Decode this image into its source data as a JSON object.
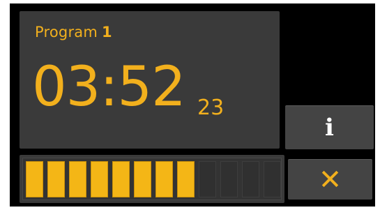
{
  "program": {
    "label": "Program",
    "number": "1"
  },
  "timer": {
    "main": "03:52",
    "seconds": "23"
  },
  "buttons": {
    "info_icon": "info-icon",
    "info_glyph": "i",
    "close_icon": "close-icon",
    "close_glyph": "✕"
  },
  "progress": {
    "filled_segments": 8,
    "total_segments": 12,
    "fraction": 0.667
  },
  "colors": {
    "accent": "#f2b01d",
    "panel": "#3a3a3a",
    "background": "#000000",
    "segment_on": "#f4b616",
    "segment_off": "#303030"
  }
}
